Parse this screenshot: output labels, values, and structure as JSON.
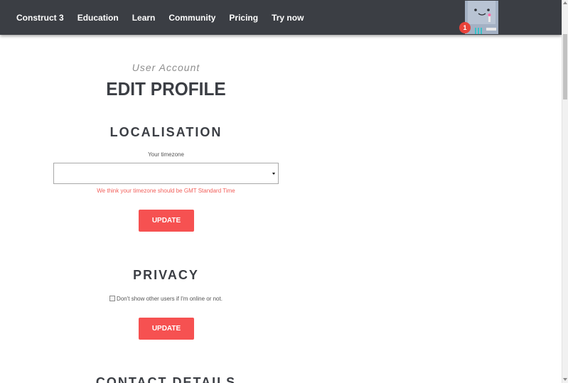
{
  "nav": {
    "items": [
      {
        "label": "Construct 3"
      },
      {
        "label": "Education"
      },
      {
        "label": "Learn"
      },
      {
        "label": "Community"
      },
      {
        "label": "Pricing"
      },
      {
        "label": "Try now"
      }
    ],
    "notification_count": "1",
    "avatar_icon": "robot-avatar-icon"
  },
  "header": {
    "subtitle": "User Account",
    "title": "EDIT PROFILE"
  },
  "localisation": {
    "heading": "LOCALISATION",
    "timezone_label": "Your timezone",
    "timezone_value": "",
    "hint": "We think your timezone should be GMT Standard Time",
    "update_label": "UPDATE"
  },
  "privacy": {
    "heading": "PRIVACY",
    "checkbox_label": "Don't show other users if I'm online or not.",
    "checked": false,
    "update_label": "UPDATE"
  },
  "contact": {
    "heading": "CONTACT DETAILS"
  },
  "colors": {
    "navbar": "#3b3e44",
    "accent": "#f65151",
    "hint": "#f2605b",
    "heading": "#3b3e44"
  }
}
